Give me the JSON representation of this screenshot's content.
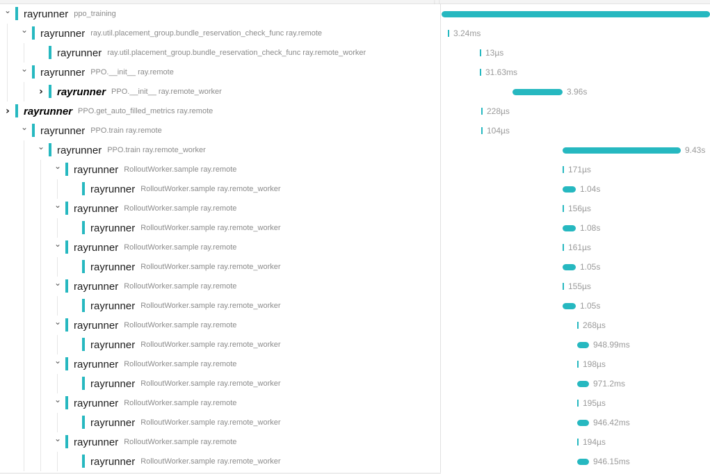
{
  "theme": {
    "accent": "#26b8c0",
    "muted_text": "#8a8a8a",
    "duration_text": "#9a9a9a"
  },
  "rows": [
    {
      "service": "rayrunner",
      "operation": "ppo_training",
      "duration": "",
      "depth": 0,
      "toggle": "open",
      "bold": false,
      "start": 0.0,
      "width": 1.0
    },
    {
      "service": "rayrunner",
      "operation": "ray.util.placement_group.bundle_reservation_check_func ray.remote",
      "duration": "3.24ms",
      "depth": 1,
      "toggle": "open",
      "bold": false,
      "start": 0.023,
      "width": 0
    },
    {
      "service": "rayrunner",
      "operation": "ray.util.placement_group.bundle_reservation_check_func ray.remote_worker",
      "duration": "13µs",
      "depth": 2,
      "toggle": "none",
      "bold": false,
      "start": 0.142,
      "width": 0
    },
    {
      "service": "rayrunner",
      "operation": "PPO.__init__ ray.remote",
      "duration": "31.63ms",
      "depth": 1,
      "toggle": "open",
      "bold": false,
      "start": 0.142,
      "width": 0
    },
    {
      "service": "rayrunner",
      "operation": "PPO.__init__ ray.remote_worker",
      "duration": "3.96s",
      "depth": 2,
      "toggle": "closed",
      "bold": true,
      "start": 0.264,
      "width": 0.186
    },
    {
      "service": "rayrunner",
      "operation": "PPO.get_auto_filled_metrics ray.remote",
      "duration": "228µs",
      "depth": 0,
      "toggle": "closed",
      "bold": true,
      "start": 0.147,
      "width": 0
    },
    {
      "service": "rayrunner",
      "operation": "PPO.train ray.remote",
      "duration": "104µs",
      "depth": 1,
      "toggle": "open",
      "bold": false,
      "start": 0.147,
      "width": 0
    },
    {
      "service": "rayrunner",
      "operation": "PPO.train ray.remote_worker",
      "duration": "9.43s",
      "depth": 2,
      "toggle": "open",
      "bold": false,
      "start": 0.45,
      "width": 0.44
    },
    {
      "service": "rayrunner",
      "operation": "RolloutWorker.sample ray.remote",
      "duration": "171µs",
      "depth": 3,
      "toggle": "open",
      "bold": false,
      "start": 0.45,
      "width": 0
    },
    {
      "service": "rayrunner",
      "operation": "RolloutWorker.sample ray.remote_worker",
      "duration": "1.04s",
      "depth": 4,
      "toggle": "none",
      "bold": false,
      "start": 0.45,
      "width": 0.05
    },
    {
      "service": "rayrunner",
      "operation": "RolloutWorker.sample ray.remote",
      "duration": "156µs",
      "depth": 3,
      "toggle": "open",
      "bold": false,
      "start": 0.45,
      "width": 0
    },
    {
      "service": "rayrunner",
      "operation": "RolloutWorker.sample ray.remote_worker",
      "duration": "1.08s",
      "depth": 4,
      "toggle": "none",
      "bold": false,
      "start": 0.45,
      "width": 0.05
    },
    {
      "service": "rayrunner",
      "operation": "RolloutWorker.sample ray.remote",
      "duration": "161µs",
      "depth": 3,
      "toggle": "open",
      "bold": false,
      "start": 0.45,
      "width": 0
    },
    {
      "service": "rayrunner",
      "operation": "RolloutWorker.sample ray.remote_worker",
      "duration": "1.05s",
      "depth": 4,
      "toggle": "none",
      "bold": false,
      "start": 0.45,
      "width": 0.05
    },
    {
      "service": "rayrunner",
      "operation": "RolloutWorker.sample ray.remote",
      "duration": "155µs",
      "depth": 3,
      "toggle": "open",
      "bold": false,
      "start": 0.45,
      "width": 0
    },
    {
      "service": "rayrunner",
      "operation": "RolloutWorker.sample ray.remote_worker",
      "duration": "1.05s",
      "depth": 4,
      "toggle": "none",
      "bold": false,
      "start": 0.45,
      "width": 0.05
    },
    {
      "service": "rayrunner",
      "operation": "RolloutWorker.sample ray.remote",
      "duration": "268µs",
      "depth": 3,
      "toggle": "open",
      "bold": false,
      "start": 0.505,
      "width": 0
    },
    {
      "service": "rayrunner",
      "operation": "RolloutWorker.sample ray.remote_worker",
      "duration": "948.99ms",
      "depth": 4,
      "toggle": "none",
      "bold": false,
      "start": 0.505,
      "width": 0.044
    },
    {
      "service": "rayrunner",
      "operation": "RolloutWorker.sample ray.remote",
      "duration": "198µs",
      "depth": 3,
      "toggle": "open",
      "bold": false,
      "start": 0.505,
      "width": 0
    },
    {
      "service": "rayrunner",
      "operation": "RolloutWorker.sample ray.remote_worker",
      "duration": "971.2ms",
      "depth": 4,
      "toggle": "none",
      "bold": false,
      "start": 0.505,
      "width": 0.044
    },
    {
      "service": "rayrunner",
      "operation": "RolloutWorker.sample ray.remote",
      "duration": "195µs",
      "depth": 3,
      "toggle": "open",
      "bold": false,
      "start": 0.505,
      "width": 0
    },
    {
      "service": "rayrunner",
      "operation": "RolloutWorker.sample ray.remote_worker",
      "duration": "946.42ms",
      "depth": 4,
      "toggle": "none",
      "bold": false,
      "start": 0.505,
      "width": 0.044
    },
    {
      "service": "rayrunner",
      "operation": "RolloutWorker.sample ray.remote",
      "duration": "194µs",
      "depth": 3,
      "toggle": "open",
      "bold": false,
      "start": 0.505,
      "width": 0
    },
    {
      "service": "rayrunner",
      "operation": "RolloutWorker.sample ray.remote_worker",
      "duration": "946.15ms",
      "depth": 4,
      "toggle": "none",
      "bold": false,
      "start": 0.505,
      "width": 0.044
    }
  ]
}
